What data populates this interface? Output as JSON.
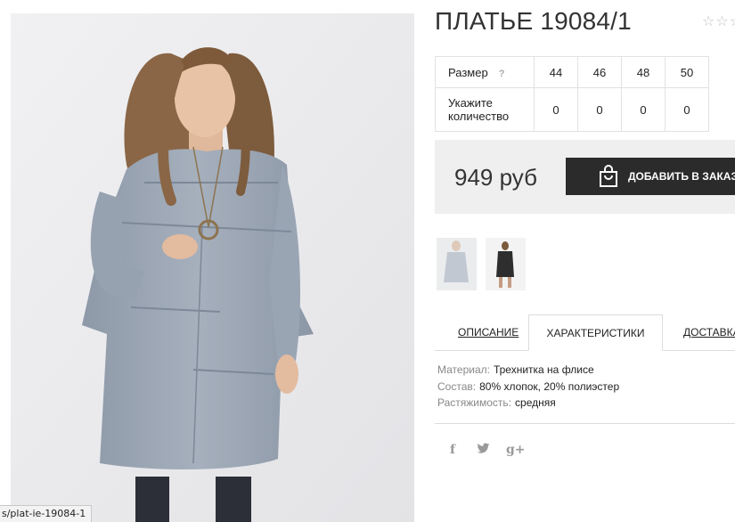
{
  "product": {
    "title": "ПЛАТЬЕ 19084/1",
    "rating_stars": "☆☆☆",
    "price": "949 руб"
  },
  "sizes": {
    "size_label": "Размер",
    "help_mark": "?",
    "values": [
      "44",
      "46",
      "48",
      "50"
    ],
    "qty_label": "Укажите количество",
    "quantities": [
      "0",
      "0",
      "0",
      "0"
    ]
  },
  "cart": {
    "add_label": "ДОБАВИТЬ В ЗАКАЗ",
    "icon": "shopping-bag-icon"
  },
  "tabs": [
    {
      "label": "ОПИСАНИЕ"
    },
    {
      "label": "ХАРАКТЕРИСТИКИ",
      "active": true
    },
    {
      "label": "ДОСТАВКА"
    }
  ],
  "specs": [
    {
      "key": "Материал:",
      "value": "Трехнитка на флисе"
    },
    {
      "key": "Состав:",
      "value": "80% хлопок, 20% полиэстер"
    },
    {
      "key": "Растяжимость:",
      "value": "средняя"
    }
  ],
  "social": {
    "facebook": "f",
    "twitter": "twitter-icon",
    "googleplus": "g+"
  },
  "status_bar": {
    "url": "s/plat-ie-19084-1"
  },
  "colors": {
    "button_bg": "#2b2b2b",
    "price_bg": "#efefef",
    "dress": "#9aa5b4"
  }
}
